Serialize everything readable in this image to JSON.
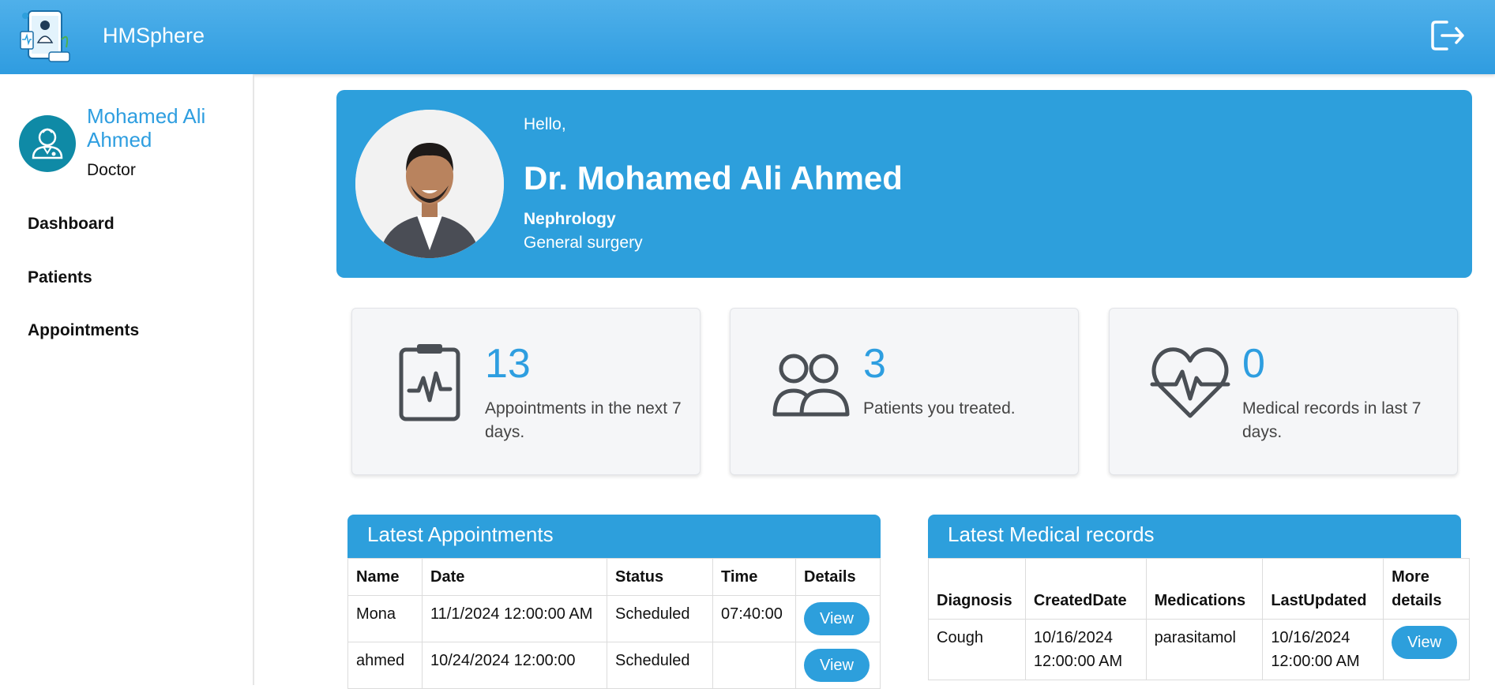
{
  "app": {
    "title": "HMSphere"
  },
  "sidebar": {
    "user_name": "Mohamed Ali Ahmed",
    "user_role": "Doctor",
    "items": [
      {
        "label": "Dashboard"
      },
      {
        "label": "Patients"
      },
      {
        "label": "Appointments"
      }
    ]
  },
  "hero": {
    "greeting": "Hello,",
    "doctor_name": "Dr. Mohamed Ali Ahmed",
    "department": "Nephrology",
    "specialty": "General surgery"
  },
  "stats": [
    {
      "value": "13",
      "label": "Appointments in the next 7 days.",
      "icon": "clipboard-pulse-icon"
    },
    {
      "value": "3",
      "label": "Patients you treated.",
      "icon": "users-icon"
    },
    {
      "value": "0",
      "label": "Medical records in last 7 days.",
      "icon": "heart-pulse-icon"
    }
  ],
  "appointments": {
    "title": "Latest Appointments",
    "columns": [
      "Name",
      "Date",
      "Status",
      "Time",
      "Details"
    ],
    "rows": [
      {
        "name": "Mona",
        "date": "11/1/2024 12:00:00 AM",
        "status": "Scheduled",
        "time": "07:40:00",
        "action": "View"
      },
      {
        "name": "ahmed",
        "date": "10/24/2024 12:00:00",
        "status": "Scheduled",
        "time": "",
        "action": "View"
      }
    ]
  },
  "records": {
    "title": "Latest Medical records",
    "columns": [
      "Diagnosis",
      "CreatedDate",
      "Medications",
      "LastUpdated",
      "More details"
    ],
    "rows": [
      {
        "diagnosis": "Cough",
        "created": "10/16/2024 12:00:00 AM",
        "medications": "parasitamol",
        "updated": "10/16/2024 12:00:00 AM",
        "action": "View"
      }
    ]
  },
  "colors": {
    "primary": "#2d9fdc",
    "accent_text": "#2e9ee0"
  }
}
